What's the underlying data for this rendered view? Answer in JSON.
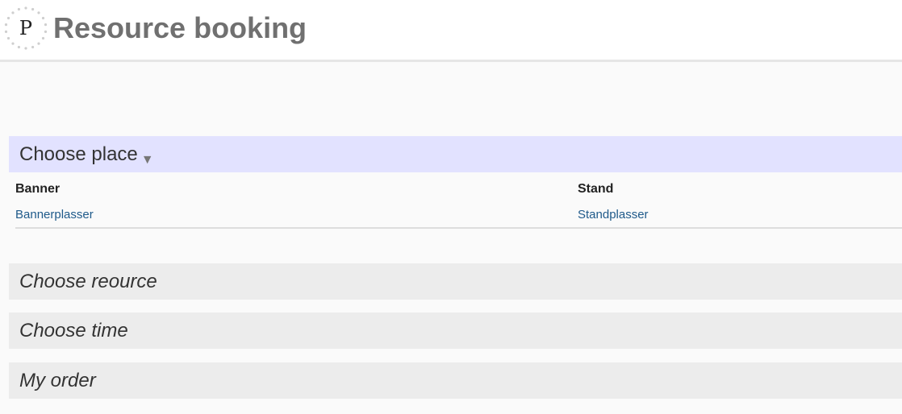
{
  "header": {
    "logo_letter": "P",
    "title": "Resource booking"
  },
  "sections": {
    "place": {
      "label": "Choose place",
      "columns": [
        {
          "header": "Banner",
          "link": "Bannerplasser"
        },
        {
          "header": "Stand",
          "link": "Standplasser"
        }
      ]
    },
    "resource": {
      "label": "Choose reource"
    },
    "time": {
      "label": "Choose time"
    },
    "order": {
      "label": "My order"
    }
  }
}
